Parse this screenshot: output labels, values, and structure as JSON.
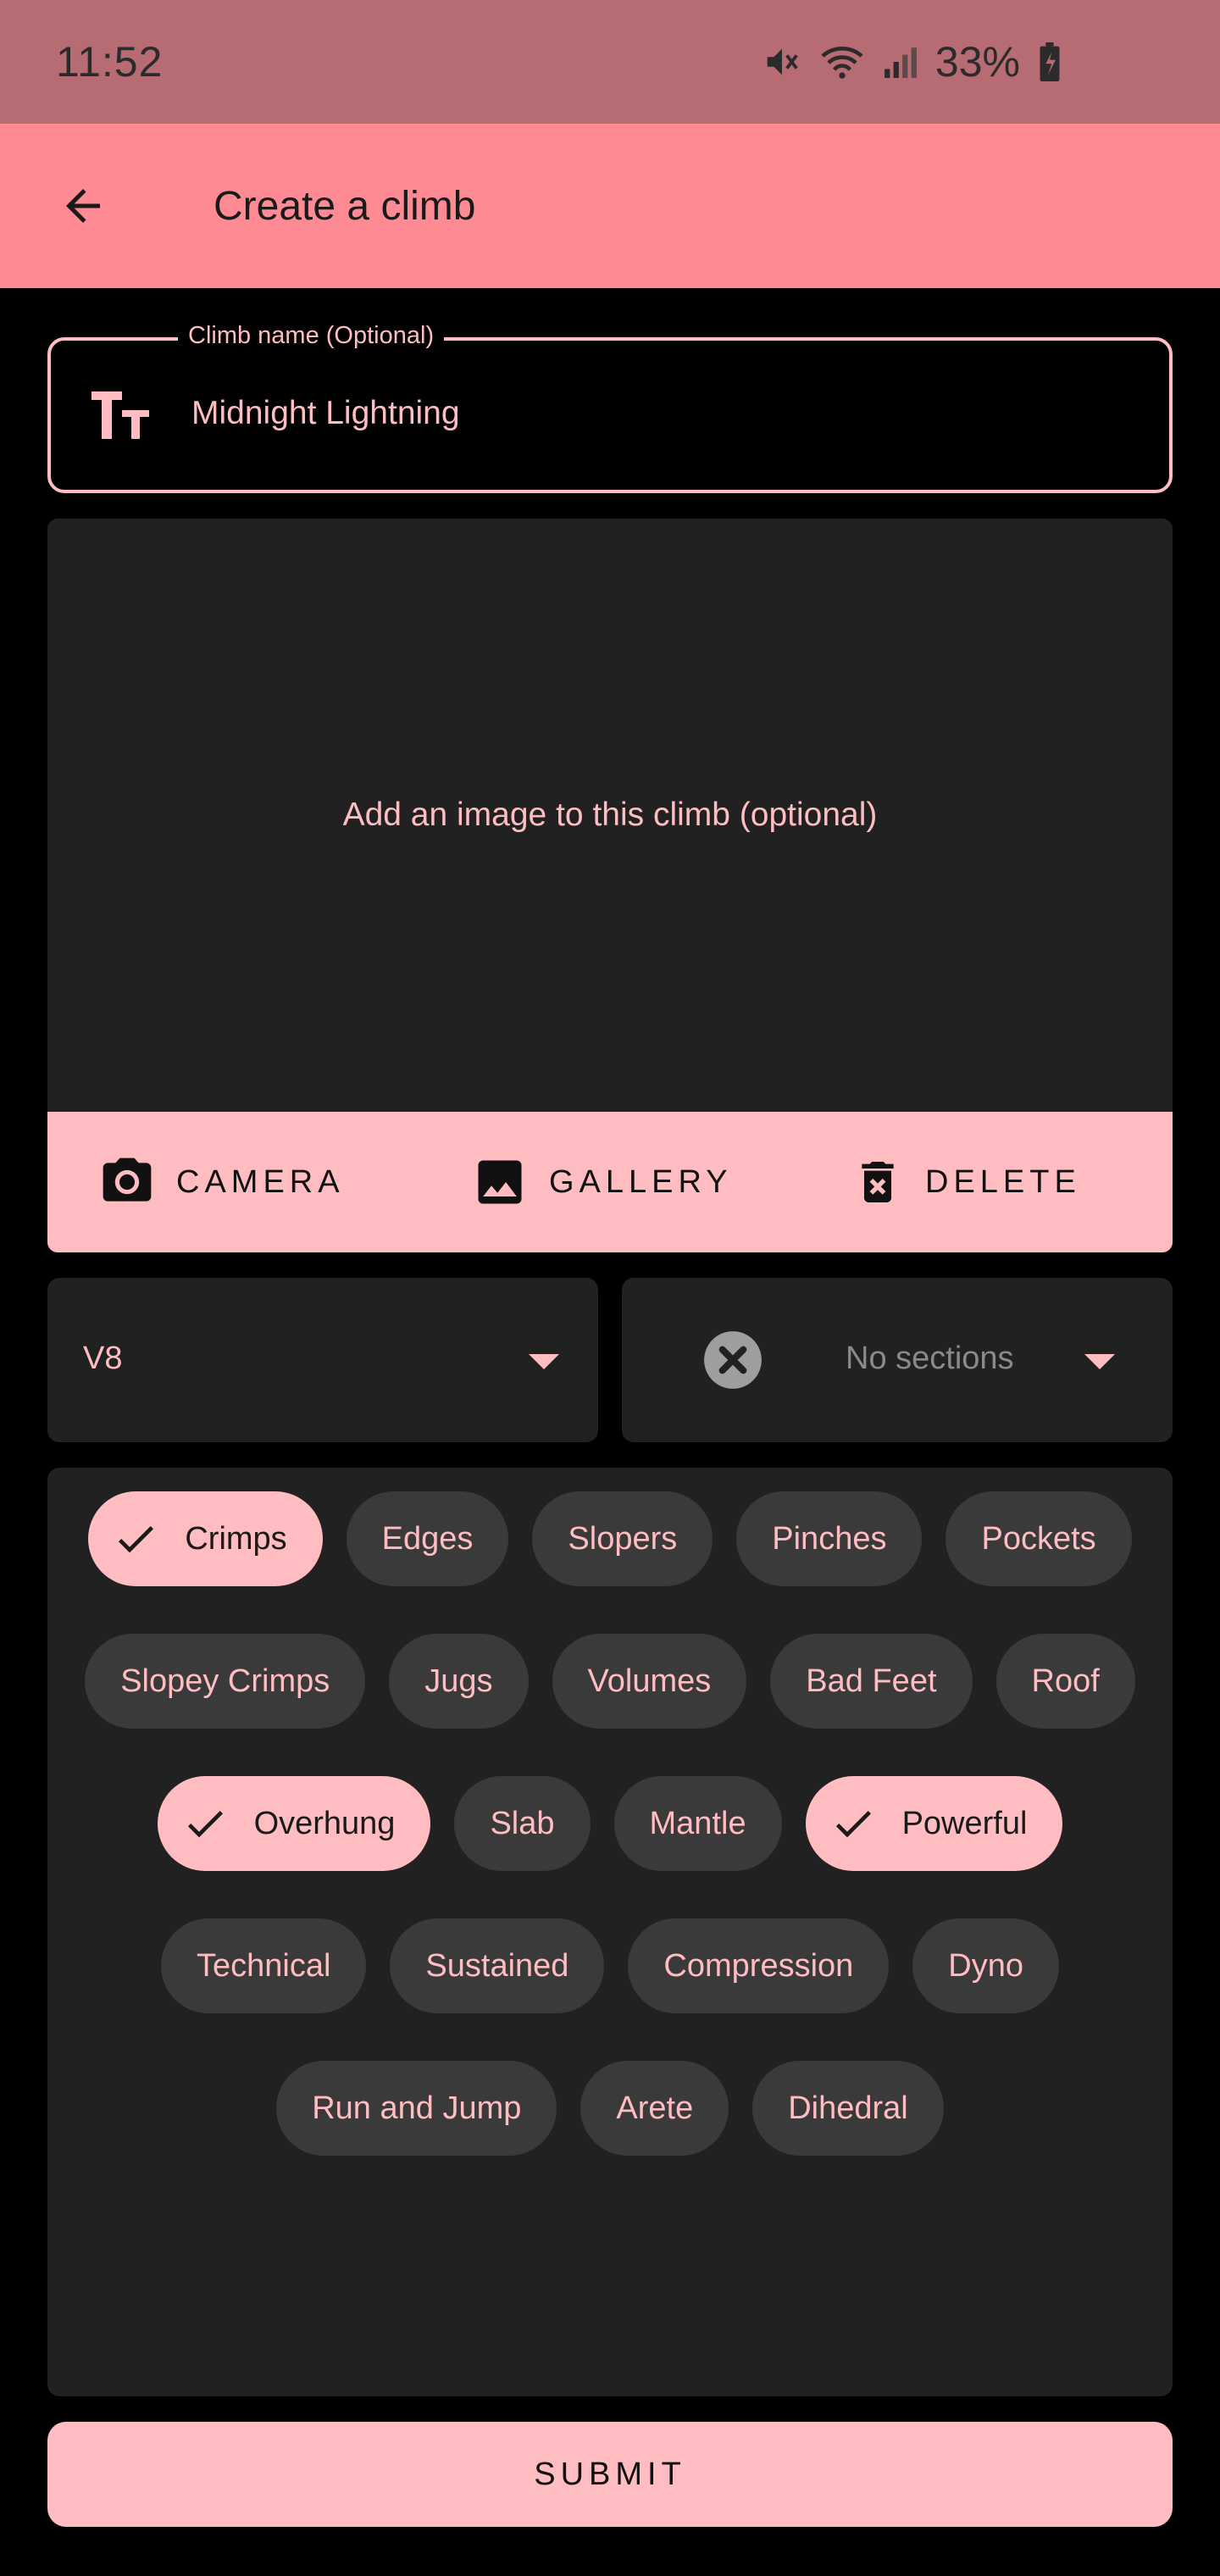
{
  "status_bar": {
    "time": "11:52",
    "battery": "33%"
  },
  "app_bar": {
    "title": "Create a climb"
  },
  "name_field": {
    "label": "Climb name (Optional)",
    "value": "Midnight Lightning"
  },
  "image_card": {
    "placeholder": "Add an image to this climb (optional)",
    "camera_label": "CAMERA",
    "gallery_label": "GALLERY",
    "delete_label": "DELETE"
  },
  "grade": {
    "value": "V8"
  },
  "sections": {
    "value": "No sections"
  },
  "chips": {
    "row1": [
      {
        "label": "Crimps",
        "selected": true
      },
      {
        "label": "Edges",
        "selected": false
      },
      {
        "label": "Slopers",
        "selected": false
      },
      {
        "label": "Pinches",
        "selected": false
      },
      {
        "label": "Pockets",
        "selected": false
      }
    ],
    "row2": [
      {
        "label": "Slopey Crimps",
        "selected": false
      },
      {
        "label": "Jugs",
        "selected": false
      },
      {
        "label": "Volumes",
        "selected": false
      },
      {
        "label": "Bad Feet",
        "selected": false
      },
      {
        "label": "Roof",
        "selected": false
      }
    ],
    "row3": [
      {
        "label": "Overhung",
        "selected": true
      },
      {
        "label": "Slab",
        "selected": false
      },
      {
        "label": "Mantle",
        "selected": false
      },
      {
        "label": "Powerful",
        "selected": true
      }
    ],
    "row4": [
      {
        "label": "Technical",
        "selected": false
      },
      {
        "label": "Sustained",
        "selected": false
      },
      {
        "label": "Compression",
        "selected": false
      },
      {
        "label": "Dyno",
        "selected": false
      }
    ],
    "row5": [
      {
        "label": "Run and Jump",
        "selected": false
      },
      {
        "label": "Arete",
        "selected": false
      },
      {
        "label": "Dihedral",
        "selected": false
      }
    ]
  },
  "submit_label": "SUBMIT",
  "colors": {
    "accent": "#ffbdc1",
    "app_bar": "#fe8b94",
    "status_bar": "#b76c74",
    "surface": "#212121",
    "chip": "#3a3a3a"
  }
}
